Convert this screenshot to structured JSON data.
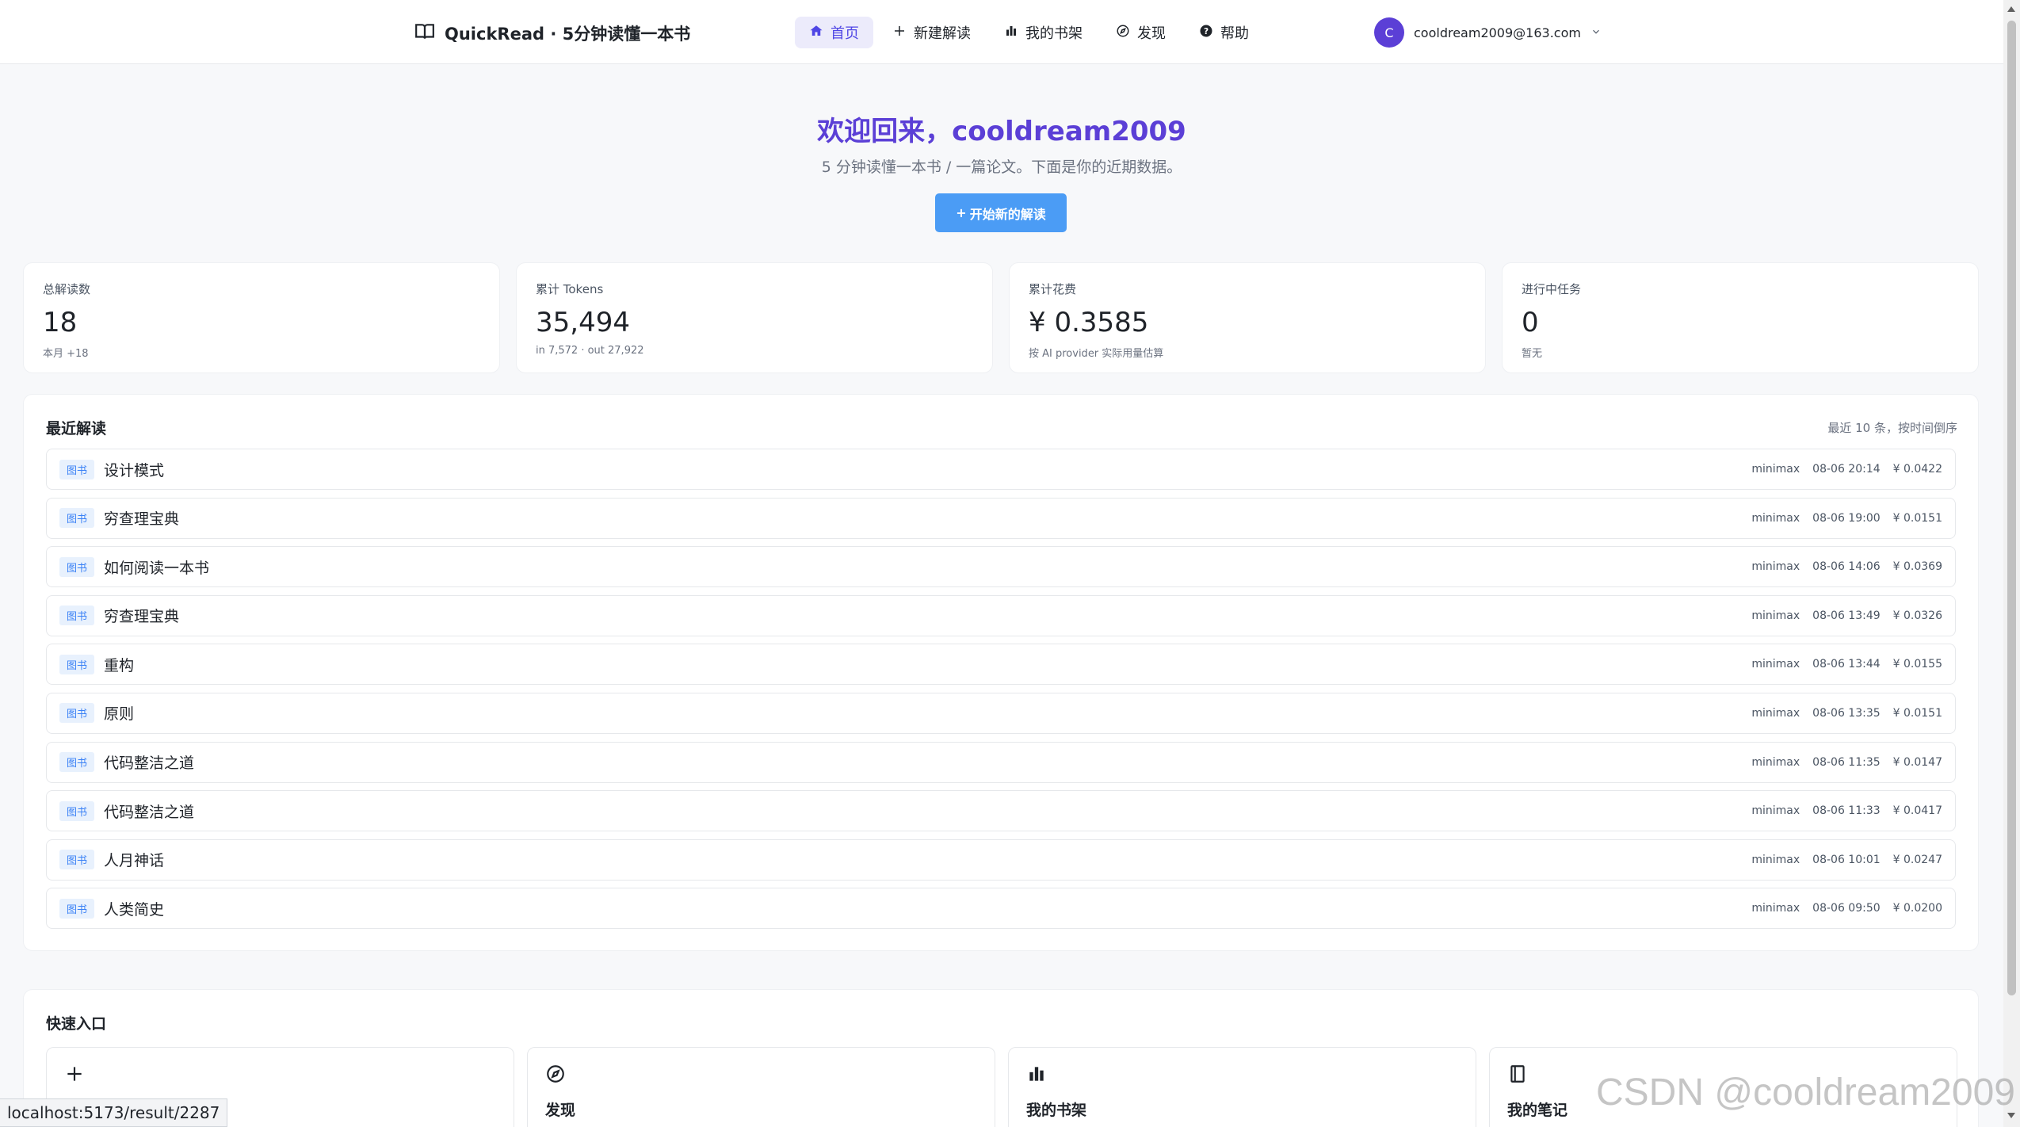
{
  "header": {
    "brand": "QuickRead · 5分钟读懂一本书",
    "nav": [
      {
        "label": "首页",
        "active": true
      },
      {
        "label": "新建解读",
        "active": false
      },
      {
        "label": "我的书架",
        "active": false
      },
      {
        "label": "发现",
        "active": false
      },
      {
        "label": "帮助",
        "active": false
      }
    ],
    "user": {
      "initial": "C",
      "email": "cooldream2009@163.com"
    }
  },
  "hero": {
    "title": "欢迎回来，cooldream2009",
    "subtitle": "5 分钟读懂一本书 / 一篇论文。下面是你的近期数据。",
    "button": "开始新的解读"
  },
  "stats": [
    {
      "label": "总解读数",
      "value": "18",
      "note": "本月 +18"
    },
    {
      "label": "累计 Tokens",
      "value": "35,494",
      "note": "in 7,572 · out 27,922"
    },
    {
      "label": "累计花费",
      "value": "¥ 0.3585",
      "note": "按 AI provider 实际用量估算"
    },
    {
      "label": "进行中任务",
      "value": "0",
      "note": "暂无"
    }
  ],
  "recent": {
    "title": "最近解读",
    "meta": "最近 10 条，按时间倒序",
    "rows": [
      {
        "tag": "图书",
        "title": "设计模式",
        "model": "minimax",
        "time": "08-06 20:14",
        "cost": "¥ 0.0422"
      },
      {
        "tag": "图书",
        "title": "穷查理宝典",
        "model": "minimax",
        "time": "08-06 19:00",
        "cost": "¥ 0.0151"
      },
      {
        "tag": "图书",
        "title": "如何阅读一本书",
        "model": "minimax",
        "time": "08-06 14:06",
        "cost": "¥ 0.0369"
      },
      {
        "tag": "图书",
        "title": "穷查理宝典",
        "model": "minimax",
        "time": "08-06 13:49",
        "cost": "¥ 0.0326"
      },
      {
        "tag": "图书",
        "title": "重构",
        "model": "minimax",
        "time": "08-06 13:44",
        "cost": "¥ 0.0155"
      },
      {
        "tag": "图书",
        "title": "原则",
        "model": "minimax",
        "time": "08-06 13:35",
        "cost": "¥ 0.0151"
      },
      {
        "tag": "图书",
        "title": "代码整洁之道",
        "model": "minimax",
        "time": "08-06 11:35",
        "cost": "¥ 0.0147"
      },
      {
        "tag": "图书",
        "title": "代码整洁之道",
        "model": "minimax",
        "time": "08-06 11:33",
        "cost": "¥ 0.0417"
      },
      {
        "tag": "图书",
        "title": "人月神话",
        "model": "minimax",
        "time": "08-06 10:01",
        "cost": "¥ 0.0247"
      },
      {
        "tag": "图书",
        "title": "人类简史",
        "model": "minimax",
        "time": "08-06 09:50",
        "cost": "¥ 0.0200"
      }
    ]
  },
  "quick": {
    "title": "快速入口",
    "cards": [
      {
        "icon": "plus-icon",
        "title": ""
      },
      {
        "icon": "compass-icon",
        "title": "发现"
      },
      {
        "icon": "bar-chart-icon",
        "title": "我的书架"
      },
      {
        "icon": "notebook-icon",
        "title": "我的笔记"
      }
    ]
  },
  "statusbar": "localhost:5173/result/2287",
  "watermark": "CSDN @cooldream2009",
  "colors": {
    "accent": "#5b3fd6",
    "button": "#4b9cf5",
    "tag": "#3b82f6"
  }
}
